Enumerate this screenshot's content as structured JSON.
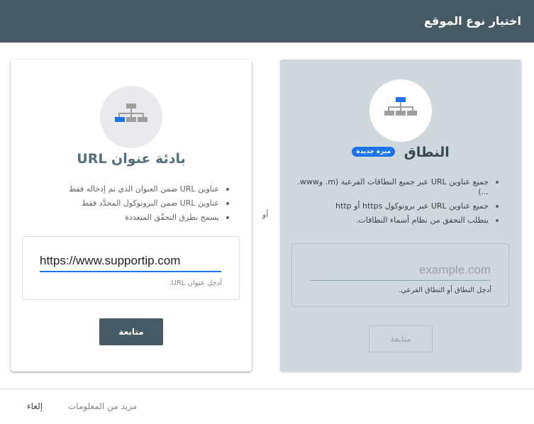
{
  "header": {
    "title": "اختيار نوع الموقع"
  },
  "domain_card": {
    "title": "النطاق",
    "badge": "ميزة جديدة",
    "features": [
      "جميع عناوين URL عبر جميع النطاقات الفرعية (m. وwww. ...)",
      "جميع عناوين URL عبر بروتوكول https أو http",
      "يتطلب التحقق من نظام أسماء النطاقات."
    ],
    "input": {
      "value": "",
      "placeholder": "example.com",
      "help": "أدخِل النطاق أو النطاق الفرعي."
    },
    "continue_label": "متابعة"
  },
  "url_card": {
    "title": "بادئة عنوان URL",
    "features": [
      "عناوين URL ضمن العنوان الذي تم إدخاله فقط",
      "عناوين URL ضمن البروتوكول المحدَّد فقط",
      "يسمح بطرق التحقّق المتعددة"
    ],
    "input": {
      "value": "https://www.supportip.com",
      "help": "أدخِل عنوان URL."
    },
    "continue_label": "متابعة"
  },
  "or_label": "أو",
  "footer": {
    "more_info": "مزيد من المعلومات",
    "cancel": "إلغاء"
  },
  "colors": {
    "header": "#455a64",
    "accent": "#1a73e8",
    "domain_bg": "#cfd8dc"
  },
  "icons": {
    "domain_card": "sitemap-icon",
    "url_card": "sitemap-icon"
  }
}
